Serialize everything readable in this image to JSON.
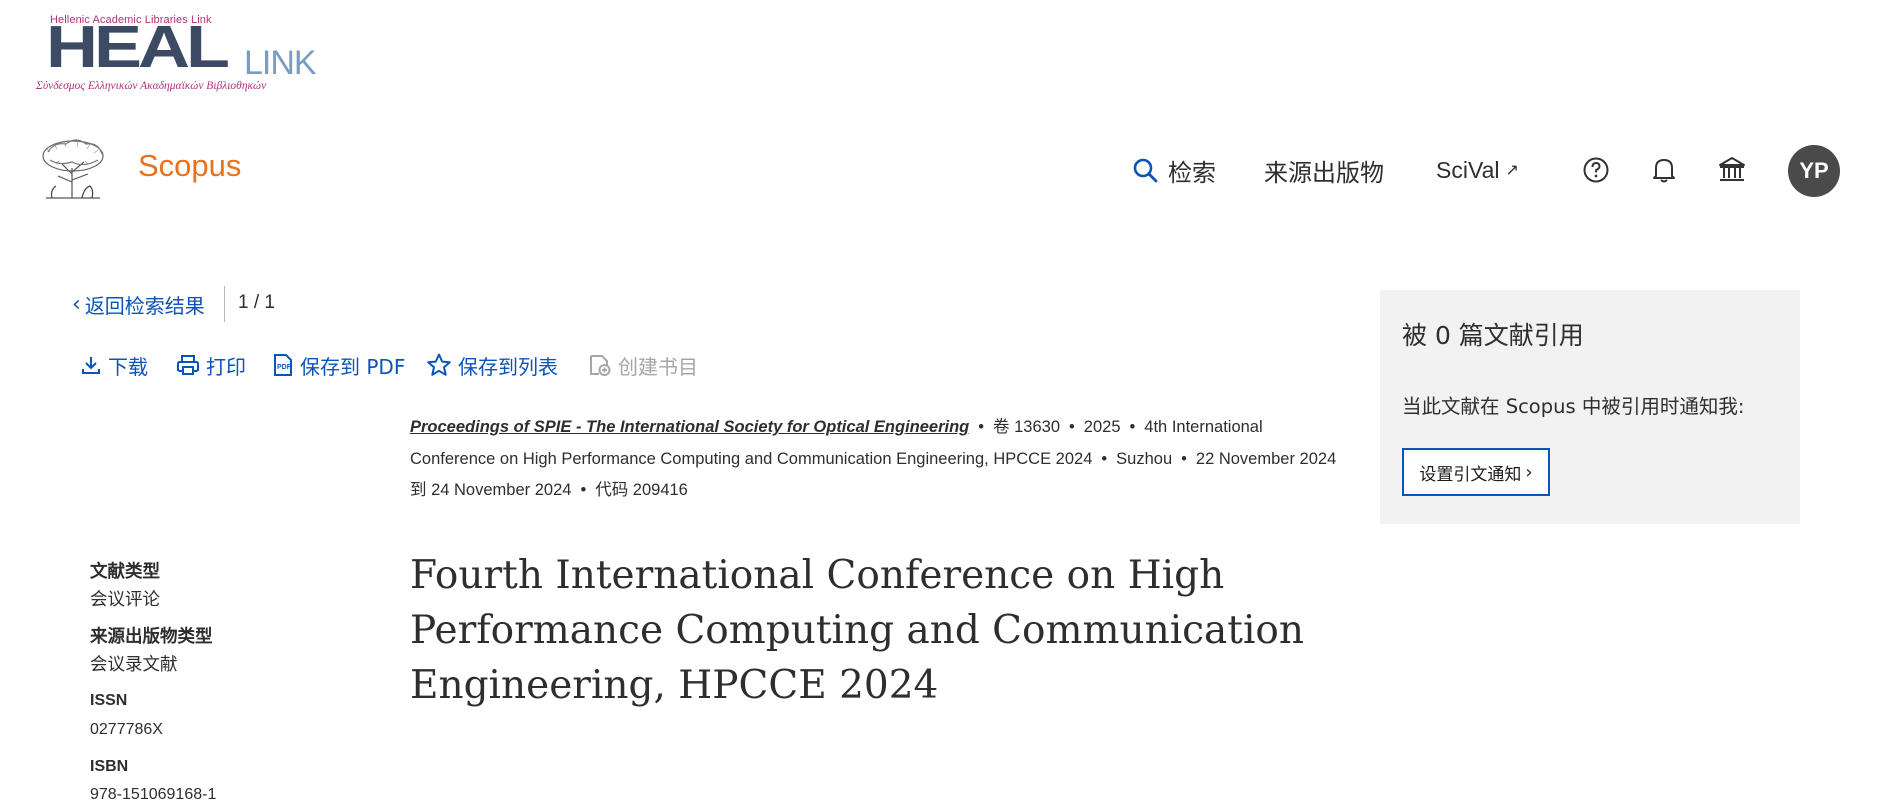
{
  "logo": {
    "top_text": "Hellenic Academic Libraries Link",
    "heal": "HEAL",
    "link": "LINK",
    "bottom_text": "Σύνδεσμος Ελληνικών Ακαδημαϊκών Βιβλιοθηκών"
  },
  "header": {
    "brand": "Scopus",
    "nav": {
      "search": "检索",
      "sources": "来源出版物",
      "scival": "SciVal",
      "scival_ext": "↗"
    },
    "avatar_initials": "YP",
    "icons": [
      "help-icon",
      "bell-icon",
      "institution-icon",
      "search-icon"
    ]
  },
  "breadcrumb": {
    "back_label": "返回检索结果",
    "pager": "1 / 1"
  },
  "toolbar": {
    "download": "下载",
    "print": "打印",
    "save_pdf": "保存到 PDF",
    "save_list": "保存到列表",
    "create_bib": "创建书目"
  },
  "source": {
    "journal": "Proceedings of SPIE - The International Society for Optical Engineering",
    "volume": "卷 13630",
    "year": "2025",
    "conference": "4th International Conference on High Performance Computing and Communication Engineering, HPCCE 2024",
    "location": "Suzhou",
    "dates": "22 November 2024到 24 November 2024",
    "code": "代码 209416",
    "separator": "•"
  },
  "document": {
    "title": "Fourth International Conference on High Performance Computing and Communication Engineering, HPCCE 2024"
  },
  "metadata": {
    "doc_type_label": "文献类型",
    "doc_type_value": "会议评论",
    "source_type_label": "来源出版物类型",
    "source_type_value": "会议录文献",
    "issn_label": "ISSN",
    "issn_value": "0277786X",
    "isbn_label": "ISBN",
    "isbn_value": "978-151069168-1"
  },
  "citations": {
    "title": "被 0 篇文献引用",
    "notify_text": "当此文献在 Scopus 中被引用时通知我:",
    "button_label": "设置引文通知"
  },
  "colors": {
    "brand_orange": "#e9711c",
    "link_blue": "#0c55b8",
    "panel_bg": "#f2f2f2",
    "avatar_bg": "#4a4a4a",
    "disabled": "#a6a6a6"
  }
}
